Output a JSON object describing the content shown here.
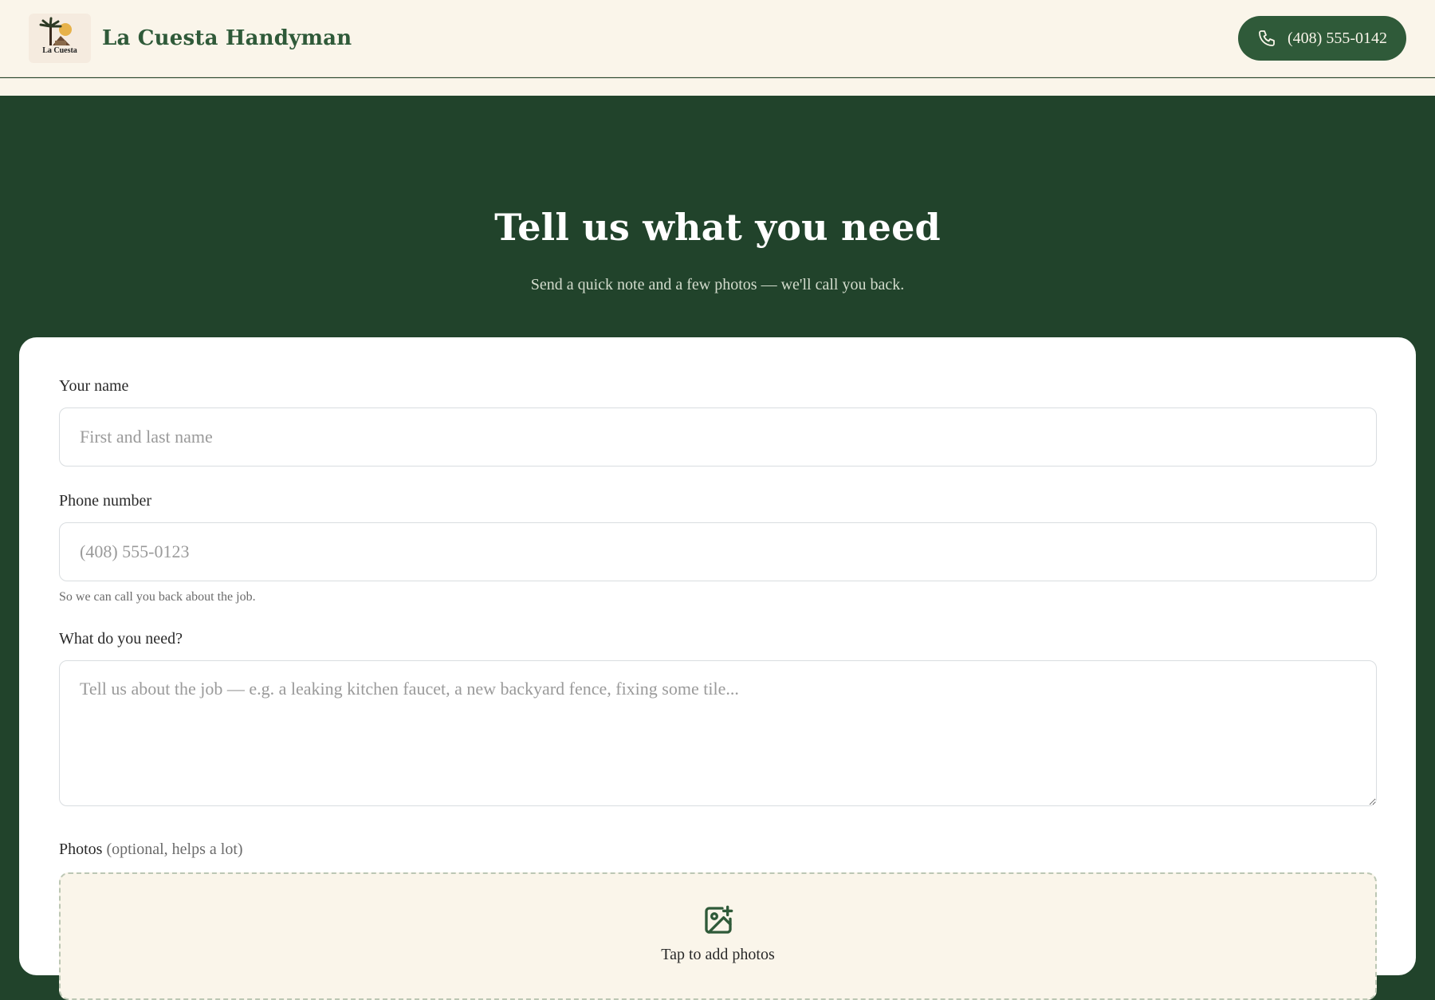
{
  "header": {
    "logo_text": "La Cuesta",
    "brand_name": "La Cuesta Handyman",
    "call_button_label": "(408) 555-0142"
  },
  "hero": {
    "title": "Tell us what you need",
    "subtitle": "Send a quick note and a few photos — we'll call you back."
  },
  "form": {
    "name": {
      "label": "Your name",
      "placeholder": "First and last name"
    },
    "phone": {
      "label": "Phone number",
      "placeholder": "(408) 555-0123",
      "hint": "So we can call you back about the job."
    },
    "need": {
      "label": "What do you need?",
      "placeholder": "Tell us about the job — e.g. a leaking kitchen faucet, a new backyard fence, fixing some tile..."
    },
    "photos": {
      "label": "Photos",
      "label_note": "(optional, helps a lot)",
      "upload_text": "Tap to add photos"
    }
  },
  "colors": {
    "brand_green": "#2f5a39",
    "hero_green": "#21432b",
    "cream": "#faf5ea"
  },
  "icons": {
    "call": "phone-icon",
    "upload": "image-plus-icon"
  }
}
